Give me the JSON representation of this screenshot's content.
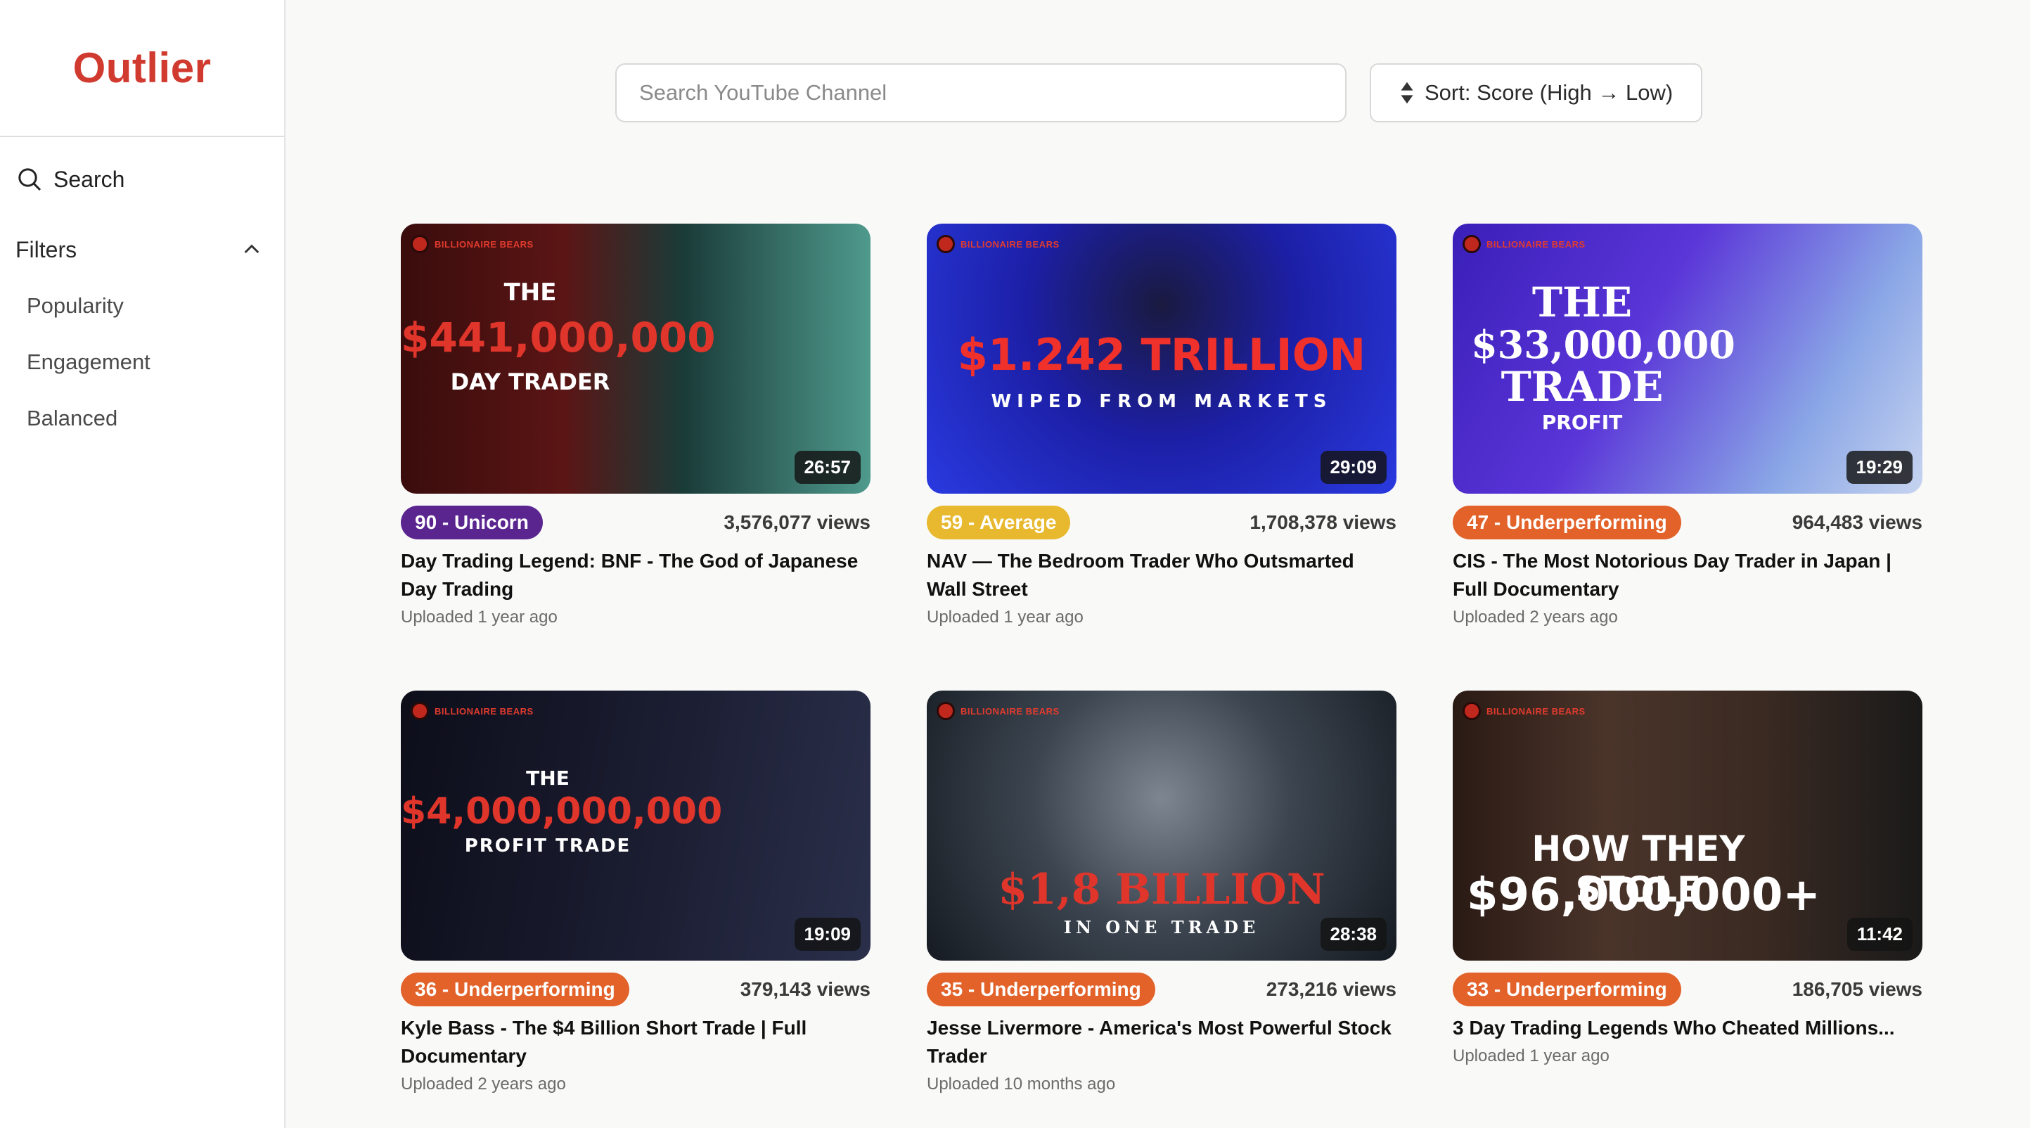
{
  "app": {
    "brand": "Outlier"
  },
  "sidebar": {
    "search_label": "Search",
    "filters_label": "Filters",
    "filter_items": [
      "Popularity",
      "Engagement",
      "Balanced"
    ]
  },
  "toolbar": {
    "search_placeholder": "Search YouTube Channel",
    "sort_label": "Sort: Score (High → Low)"
  },
  "colors": {
    "brand": "#d03a2f",
    "unicorn": "#5b2590",
    "average": "#e8b92e",
    "underperforming": "#e2622a"
  },
  "videos": [
    {
      "thumb_channel": "BILLIONAIRE BEARS",
      "thumb_text": [
        "THE",
        "$441,000,000",
        "DAY TRADER"
      ],
      "duration": "26:57",
      "badge": "90 - Unicorn",
      "views": "3,576,077 views",
      "title": "Day Trading Legend: BNF - The God of Japanese Day Trading",
      "uploaded": "Uploaded 1 year ago"
    },
    {
      "thumb_channel": "BILLIONAIRE BEARS",
      "thumb_text": [
        "$1.242 TRILLION",
        "WIPED  FROM  MARKETS"
      ],
      "duration": "29:09",
      "badge": "59 - Average",
      "views": "1,708,378 views",
      "title": "NAV — The Bedroom Trader Who Outsmarted Wall Street",
      "uploaded": "Uploaded 1 year ago"
    },
    {
      "thumb_channel": "BILLIONAIRE BEARS",
      "thumb_text": [
        "THE",
        "$33,000,000",
        "TRADE",
        "PROFIT"
      ],
      "duration": "19:29",
      "badge": "47 - Underperforming",
      "views": "964,483 views",
      "title": "CIS - The Most Notorious Day Trader in Japan | Full Documentary",
      "uploaded": "Uploaded 2 years ago"
    },
    {
      "thumb_channel": "BILLIONAIRE BEARS",
      "thumb_text": [
        "THE",
        "$4,000,000,000",
        "PROFIT TRADE"
      ],
      "duration": "19:09",
      "badge": "36 - Underperforming",
      "views": "379,143 views",
      "title": "Kyle Bass - The $4 Billion Short Trade | Full Documentary",
      "uploaded": "Uploaded 2 years ago"
    },
    {
      "thumb_channel": "BILLIONAIRE BEARS",
      "thumb_text": [
        "$1,8 BILLION",
        "IN ONE TRADE"
      ],
      "duration": "28:38",
      "badge": "35 - Underperforming",
      "views": "273,216 views",
      "title": "Jesse Livermore - America's Most Powerful Stock Trader",
      "uploaded": "Uploaded 10 months ago"
    },
    {
      "thumb_channel": "BILLIONAIRE BEARS",
      "thumb_text": [
        "HOW THEY STOLE",
        "$96,000,000+"
      ],
      "duration": "11:42",
      "badge": "33 - Underperforming",
      "views": "186,705 views",
      "title": "3 Day Trading Legends Who Cheated Millions...",
      "uploaded": "Uploaded 1 year ago"
    }
  ]
}
